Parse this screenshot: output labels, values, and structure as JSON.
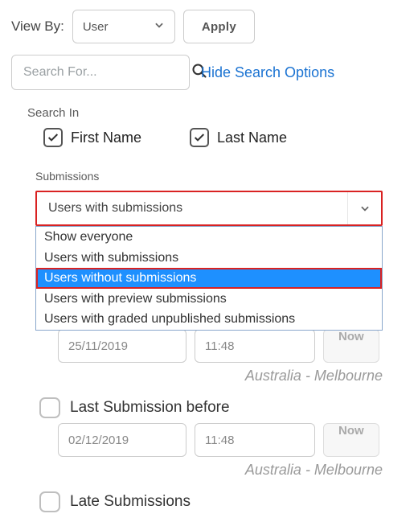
{
  "viewby": {
    "label": "View By:",
    "selected": "User",
    "apply": "Apply"
  },
  "search": {
    "placeholder": "Search For...",
    "hide_link": "Hide Search Options"
  },
  "search_in": {
    "heading": "Search In",
    "first_name": "First Name",
    "last_name": "Last Name"
  },
  "submissions": {
    "heading": "Submissions",
    "selected": "Users with submissions",
    "options": [
      "Show everyone",
      "Users with submissions",
      "Users without submissions",
      "Users with preview submissions",
      "Users with graded unpublished submissions"
    ],
    "highlighted_index": 2
  },
  "after": {
    "date": "25/11/2019",
    "time": "11:48",
    "now": "Now",
    "tz": "Australia - Melbourne"
  },
  "before": {
    "label": "Last Submission before",
    "date": "02/12/2019",
    "time": "11:48",
    "now": "Now",
    "tz": "Australia - Melbourne"
  },
  "late": {
    "label": "Late Submissions"
  }
}
